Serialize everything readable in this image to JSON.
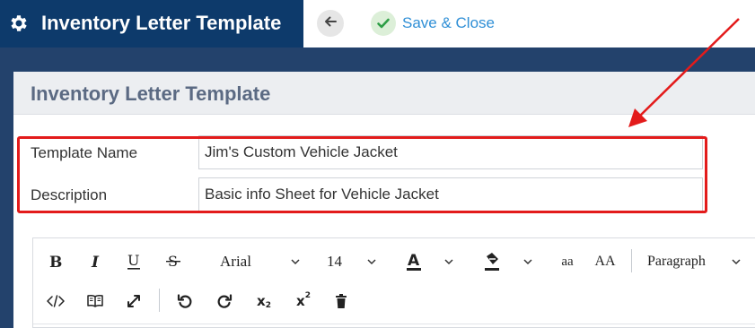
{
  "header": {
    "title": "Inventory Letter Template",
    "save_label": "Save & Close"
  },
  "panel": {
    "title": "Inventory Letter Template"
  },
  "form": {
    "template_name_label": "Template Name",
    "template_name_value": "Jim's Custom Vehicle Jacket",
    "description_label": "Description",
    "description_value": "Basic info Sheet for Vehicle Jacket"
  },
  "editor": {
    "font_family": "Arial",
    "font_size": "14",
    "lowercase_label": "aa",
    "uppercase_label": "AA",
    "block_format": "Paragraph",
    "subscript_label": "x",
    "subscript_mark": "2",
    "superscript_label": "x",
    "superscript_mark": "2"
  },
  "icons": {
    "settings": "gear-icon",
    "back": "arrow-left-icon",
    "save": "check-icon"
  },
  "colors": {
    "title_bar": "#0d3a6b",
    "background": "#23426c",
    "save_text": "#2f8fd6",
    "highlight": "#e31b1b"
  }
}
